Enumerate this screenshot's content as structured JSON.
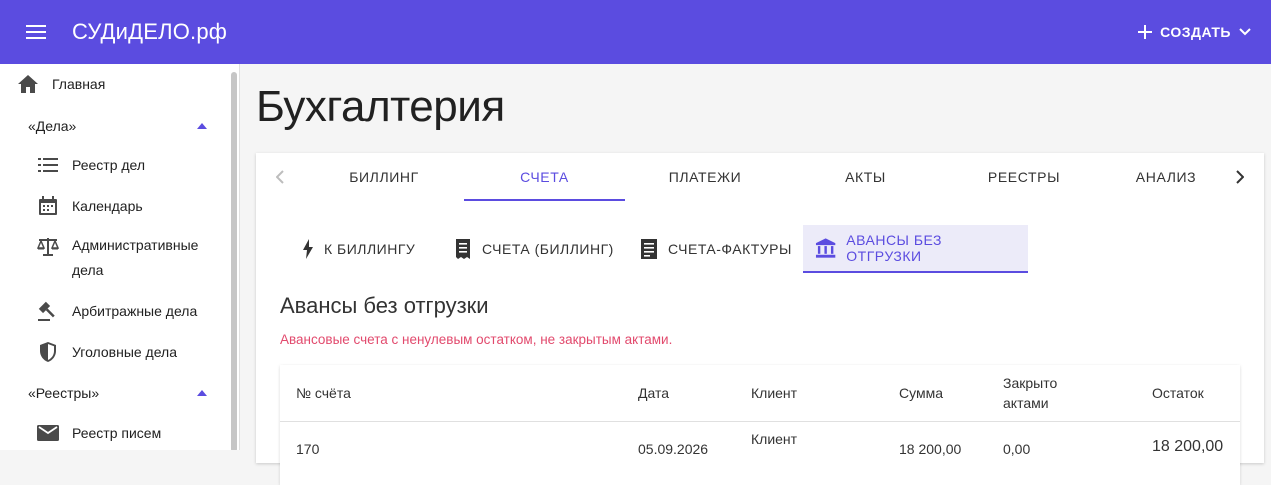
{
  "app": {
    "title": "СУДиДЕЛО.рф"
  },
  "header": {
    "create_label": "СОЗДАТЬ"
  },
  "sidebar": {
    "home": "Главная",
    "group_cases": "«Дела»",
    "items_cases": [
      {
        "label": "Реестр дел",
        "icon": "list-icon"
      },
      {
        "label": "Календарь",
        "icon": "calendar-icon"
      },
      {
        "label": "Административные",
        "label2": "дела",
        "icon": "scales-icon"
      },
      {
        "label": "Арбитражные дела",
        "icon": "gavel-icon"
      },
      {
        "label": "Уголовные дела",
        "icon": "shield-icon"
      }
    ],
    "group_registries": "«Реестры»",
    "items_registries": [
      {
        "label": "Реестр писем",
        "icon": "mail-icon"
      }
    ]
  },
  "page": {
    "title": "Бухгалтерия"
  },
  "tabs": [
    "БИЛЛИНГ",
    "СЧЕТА",
    "ПЛАТЕЖИ",
    "АКТЫ",
    "РЕЕСТРЫ",
    "АНАЛИЗ"
  ],
  "active_tab": "СЧЕТА",
  "subtabs": [
    {
      "label": "К БИЛЛИНГУ",
      "icon": "bolt-icon"
    },
    {
      "label": "СЧЕТА (БИЛЛИНГ)",
      "icon": "receipt-icon"
    },
    {
      "label": "СЧЕТА-ФАКТУРЫ",
      "icon": "invoice-icon"
    },
    {
      "label": "АВАНСЫ БЕЗ ОТГРУЗКИ",
      "icon": "bank-icon"
    }
  ],
  "section": {
    "title": "Авансы без отгрузки",
    "note": "Авансовые счета с ненулевым остатком, не закрытым актами."
  },
  "table": {
    "headers": {
      "number": "№ счёта",
      "date": "Дата",
      "client": "Клиент",
      "sum": "Сумма",
      "closed": "Закрыто",
      "closed2": "актами",
      "rest": "Остаток"
    },
    "row": {
      "number": "170",
      "date": "05.09.2026",
      "client": "Клиент",
      "sum": "18 200,00",
      "closed": "0,00",
      "rest": "18 200,00"
    }
  },
  "colors": {
    "primary": "#5b4ce0",
    "note": "#e24a6d"
  }
}
